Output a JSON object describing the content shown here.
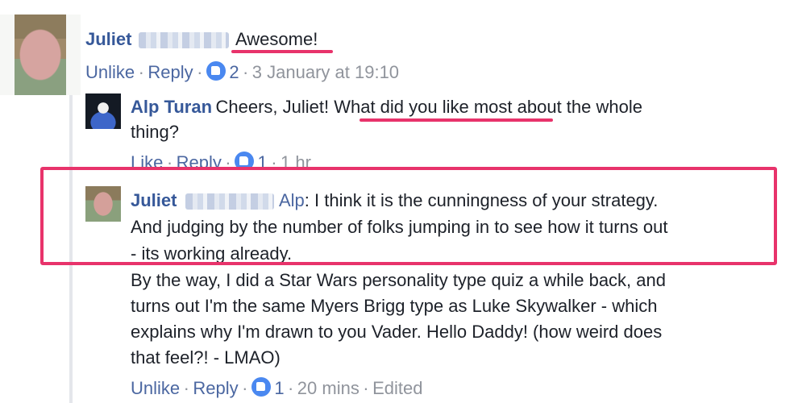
{
  "comment": {
    "author": "Juliet",
    "text": "Awesome!",
    "actions": {
      "unlike": "Unlike",
      "reply": "Reply"
    },
    "like_count": "2",
    "timestamp": "3 January at 19:10"
  },
  "reply1": {
    "author": "Alp Turan",
    "line1": "Cheers, Juliet! What did you like most about the whole",
    "line2": "thing?",
    "actions": {
      "like": "Like",
      "reply": "Reply"
    },
    "like_count": "1",
    "timestamp": "1 hr"
  },
  "reply2": {
    "author": "Juliet",
    "mention": "Alp",
    "lines": [
      ": I think it is the cunningness of your strategy.",
      "And judging by the number of folks jumping in to see how it turns out",
      "- its working already.",
      "By the way, I did a Star Wars personality type quiz a while back, and",
      "turns out I'm the same Myers Brigg type as Luke Skywalker - which",
      "explains why I'm drawn to you Vader. Hello Daddy! (how weird does",
      "that feel?! - LMAO)"
    ],
    "actions": {
      "unlike": "Unlike",
      "reply": "Reply"
    },
    "like_count": "1",
    "timestamp": "20 mins",
    "edited": "Edited"
  },
  "separator": "·",
  "colors": {
    "accent": "#e8336b",
    "link": "#365899",
    "like_blue": "#4a88f0"
  }
}
